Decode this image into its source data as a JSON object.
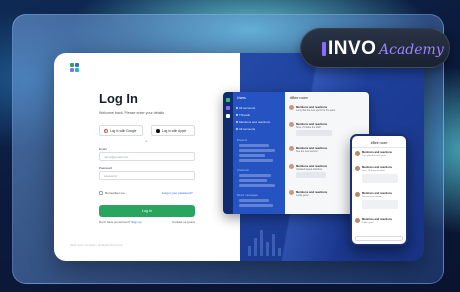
{
  "brand": {
    "name": "INVO",
    "sub": "Academy"
  },
  "login": {
    "title": "Log In",
    "subtitle": "Welcome back. Please enter your details",
    "google_btn": "Log in with Google",
    "apple_btn": "Log in with Apple",
    "or": "or",
    "email_label": "Email",
    "email_placeholder": "name@email.com",
    "password_label": "Password",
    "password_placeholder": "password",
    "remember": "Remember me",
    "forgot": "Forgot your password?",
    "submit": "Log In",
    "signup_prompt": "Don't have an account?",
    "signup_link": "Sign up",
    "contact": "Contact us (pure)",
    "copyright": "2022 Invoo Company. All Rights Reserved"
  },
  "app": {
    "sidebar_title": "Users",
    "sidebar_items": [
      "All accounts",
      "Threads",
      "Mentions and reactions",
      "All accounts"
    ],
    "section_projects": "Projects",
    "section_channels": "Channels",
    "section_direct": "Direct messages",
    "main_title": "#Bee room",
    "messages": [
      {
        "name": "Mentions and reactions",
        "text": "Let's plan the next sprint for the team"
      },
      {
        "name": "Mentions and reactions",
        "text": "Sure, I'll share the draft"
      },
      {
        "name": "Mentions and reactions",
        "text": "See the new version"
      },
      {
        "name": "Mentions and reactions",
        "text": "Updated layout attached"
      },
      {
        "name": "Mentions and reactions",
        "text": "Looks good"
      }
    ]
  },
  "phone": {
    "title": "#Bee room",
    "messages": [
      {
        "name": "Mentions and reactions",
        "text": "Let's plan the next sprint"
      },
      {
        "name": "Mentions and reactions",
        "text": "Sure, I'll share the draft"
      },
      {
        "name": "Mentions and reactions",
        "text": "See the new version"
      },
      {
        "name": "Mentions and reactions",
        "text": "Looks good"
      }
    ]
  }
}
